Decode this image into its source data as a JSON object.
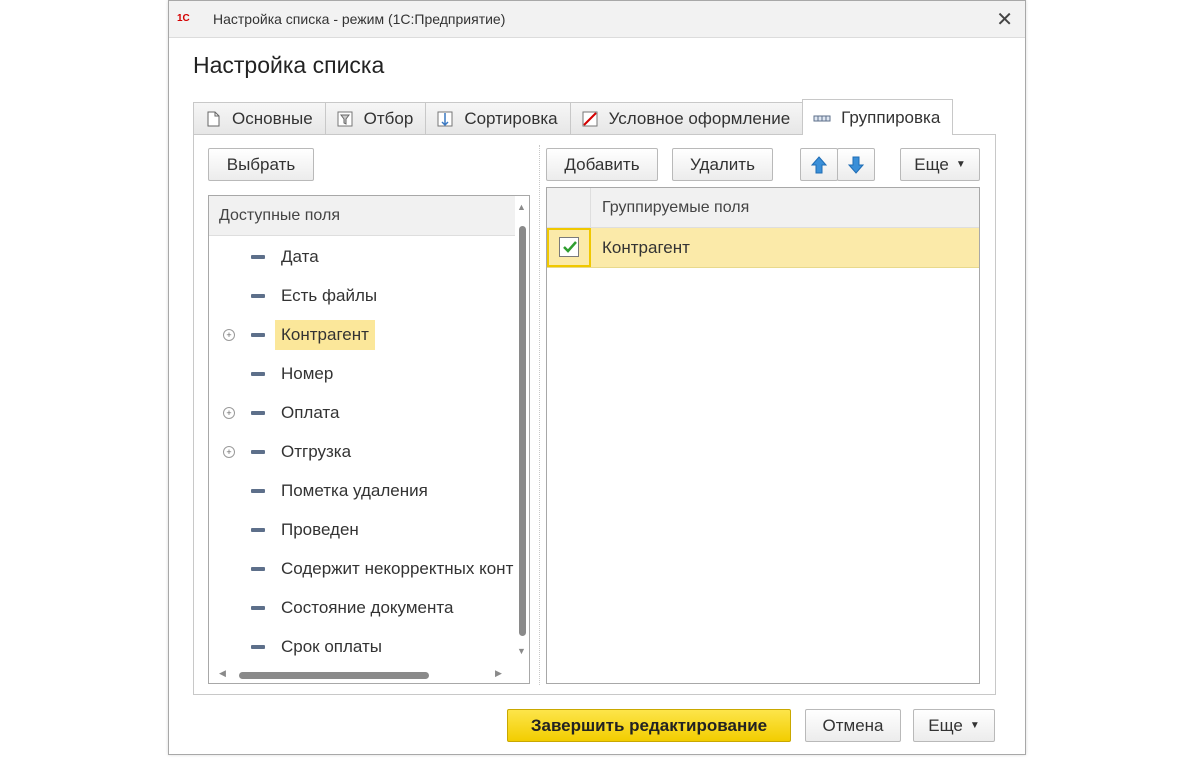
{
  "window": {
    "app_logo": "1С",
    "title": "Настройка списка - режим  (1С:Предприятие)",
    "close_label": "✕"
  },
  "form": {
    "title": "Настройка списка"
  },
  "tabs": [
    {
      "label": "Основные",
      "icon": "document-icon"
    },
    {
      "label": "Отбор",
      "icon": "filter-icon"
    },
    {
      "label": "Сортировка",
      "icon": "sort-icon"
    },
    {
      "label": "Условное оформление",
      "icon": "conditional-format-icon"
    },
    {
      "label": "Группировка",
      "icon": "grouping-icon",
      "active": true
    }
  ],
  "left_panel": {
    "select_button": "Выбрать",
    "header": "Доступные поля",
    "fields": [
      {
        "label": "Дата",
        "expandable": false
      },
      {
        "label": "Есть файлы",
        "expandable": false
      },
      {
        "label": "Контрагент",
        "expandable": true,
        "selected": true
      },
      {
        "label": "Номер",
        "expandable": false
      },
      {
        "label": "Оплата",
        "expandable": true
      },
      {
        "label": "Отгрузка",
        "expandable": true
      },
      {
        "label": "Пометка удаления",
        "expandable": false
      },
      {
        "label": "Проведен",
        "expandable": false
      },
      {
        "label": "Содержит некорректных конт",
        "expandable": false
      },
      {
        "label": "Состояние документа",
        "expandable": false
      },
      {
        "label": "Срок оплаты",
        "expandable": false
      }
    ]
  },
  "right_panel": {
    "add_button": "Добавить",
    "delete_button": "Удалить",
    "more_button": "Еще",
    "header": "Группируемые поля",
    "rows": [
      {
        "label": "Контрагент",
        "checked": true
      }
    ]
  },
  "footer": {
    "finish_button": "Завершить редактирование",
    "cancel_button": "Отмена",
    "more_button": "Еще"
  },
  "colors": {
    "primary_button": "#f2cd00",
    "selection": "#fbe79a",
    "arrow": "#3a8fd8",
    "check": "#2f9e2f"
  }
}
